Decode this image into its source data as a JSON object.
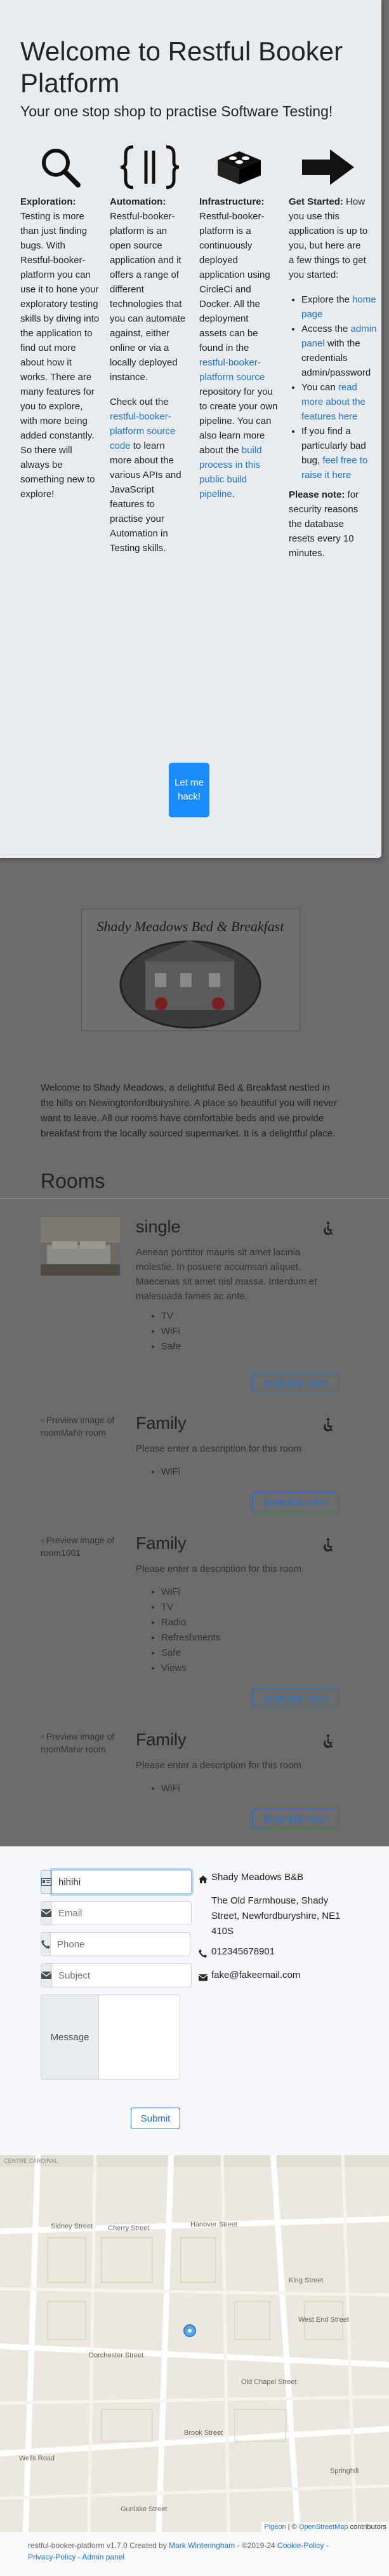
{
  "modal": {
    "title": "Welcome to Restful Booker Platform",
    "tagline": "Your one stop shop to practise Software Testing!",
    "columns": [
      {
        "icon": "magnifier-icon",
        "heading": "Exploration:",
        "body": "Testing is more than just finding bugs. With Restful-booker-platform you can use it to hone your exploratory testing skills by diving into the application to find out more about how it works. There are many features for you to explore, with more being added constantly. So there will always be something new to explore!"
      },
      {
        "icon": "braces-icon",
        "heading": "Automation:",
        "body": "Restful-booker-platform is an open source application and it offers a range of different technologies that you can automate against, either online or via a locally deployed instance.",
        "body2_pre": "Check out the",
        "body2_link": "restful-booker-platform source code",
        "body2_post": "to learn more about the various APIs and JavaScript features to practise your Automation in Testing skills."
      },
      {
        "icon": "bricks-icon",
        "heading": "Infrastructure:",
        "body_pre": "Restful-booker-platform is a continuously deployed application using CircleCi and Docker. All the deployment assets can be found in the",
        "body_link": "restful-booker-platform source",
        "body_mid": "repository for you to create your own pipeline. You can also learn more about the",
        "body_link2": "build process in this public build pipeline",
        "body_post": "."
      },
      {
        "icon": "arrow-right-icon",
        "heading": "Get Started:",
        "body": "How you use this application is up to you, but here are a few things to get you started:",
        "list": [
          {
            "pre": "Explore the",
            "link": "home page",
            "post": ""
          },
          {
            "pre": "Access the",
            "link": "admin panel",
            "post": "with the credentials admin/password"
          },
          {
            "pre": "You can",
            "link": "read more about the features here",
            "post": ""
          },
          {
            "pre": "If you find a particularly bad bug,",
            "link": "feel free to raise it here",
            "post": ""
          }
        ],
        "note_heading": "Please note:",
        "note": "for security reasons the database resets every 10 minutes."
      }
    ],
    "button_label": "Let me hack!"
  },
  "hero": {
    "sign_text": "Shady Meadows Bed & Breakfast"
  },
  "intro": "Welcome to Shady Meadows, a delightful Bed & Breakfast nestled in the hills on Newingtonfordburyshire. A place so beautiful you will never want to leave. All our rooms have comfortable beds and we provide breakfast from the locally sourced supermarket. It is a delightful place.",
  "rooms_heading": "Rooms",
  "rooms": [
    {
      "name": "single",
      "image_alt": "",
      "has_image": true,
      "description": "Aenean porttitor mauris sit amet lacinia molestie. In posuere accumsan aliquet. Maecenas sit amet nisl massa. Interdum et malesuada fames ac ante.",
      "features": [
        "TV",
        "WiFi",
        "Safe"
      ],
      "book_label": "Book this room"
    },
    {
      "name": "Family",
      "image_alt": "Preview image of roomMahir room",
      "has_image": false,
      "description": "Please enter a description for this room",
      "features": [
        "WiFi"
      ],
      "book_label": "Book this room"
    },
    {
      "name": "Family",
      "image_alt": "Preview image of room1001",
      "has_image": false,
      "description": "Please enter a description for this room",
      "features": [
        "WiFi",
        "TV",
        "Radio",
        "Refreshments",
        "Safe",
        "Views"
      ],
      "book_label": "Book this room"
    },
    {
      "name": "Family",
      "image_alt": "Preview image of roomMahir room",
      "has_image": false,
      "description": "Please enter a description for this room",
      "features": [
        "WiFi"
      ],
      "book_label": "Book this room"
    }
  ],
  "contact": {
    "name_value": "hihihi",
    "email_placeholder": "Email",
    "phone_placeholder": "Phone",
    "subject_placeholder": "Subject",
    "message_label": "Message",
    "submit_label": "Submit",
    "business_name": "Shady Meadows B&B",
    "address": "The Old Farmhouse, Shady Street, Newfordburyshire, NE1 410S",
    "phone": "012345678901",
    "email": "fake@fakeemail.com"
  },
  "map": {
    "labels": [
      "CENTRE CARDINAL",
      "Sidney Street",
      "Cherry Street",
      "Hanover Street",
      "Dorchester Street",
      "King Street",
      "Wells Road",
      "Brook Street",
      "West End Street",
      "Old Chapel Street",
      "Springhill",
      "Gunlake Street"
    ],
    "attribution_link1": "Pigeon",
    "attribution_sep": " | © ",
    "attribution_link2": "OpenStreetMap",
    "attribution_post": " contributors"
  },
  "footer": {
    "pre": "restful-booker-platform v1.7.0 Created by",
    "author": "Mark Winteringham",
    "mid": "- ©2019-24",
    "cookie": "Cookie-Policy",
    "dash": " - ",
    "privacy": "Privacy-Policy",
    "dash2": " - ",
    "admin": "Admin panel"
  },
  "colors": {
    "primary": "#1a8cff",
    "link": "#1e73d6",
    "modal_bg": "#e9ecef",
    "overlay": "#6b6b6b"
  }
}
